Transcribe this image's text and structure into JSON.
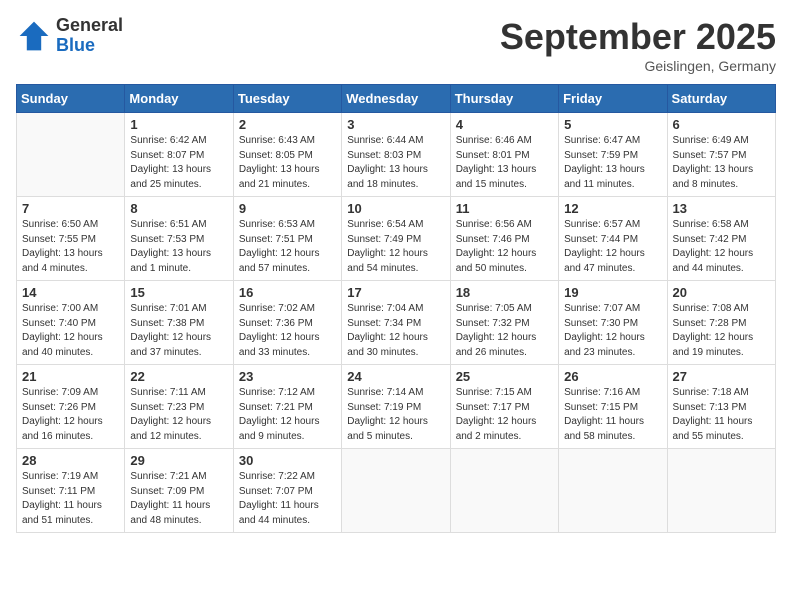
{
  "header": {
    "logo_general": "General",
    "logo_blue": "Blue",
    "month_title": "September 2025",
    "location": "Geislingen, Germany"
  },
  "days_of_week": [
    "Sunday",
    "Monday",
    "Tuesday",
    "Wednesday",
    "Thursday",
    "Friday",
    "Saturday"
  ],
  "weeks": [
    [
      {
        "day": "",
        "sunrise": "",
        "sunset": "",
        "daylight": ""
      },
      {
        "day": "1",
        "sunrise": "Sunrise: 6:42 AM",
        "sunset": "Sunset: 8:07 PM",
        "daylight": "Daylight: 13 hours and 25 minutes."
      },
      {
        "day": "2",
        "sunrise": "Sunrise: 6:43 AM",
        "sunset": "Sunset: 8:05 PM",
        "daylight": "Daylight: 13 hours and 21 minutes."
      },
      {
        "day": "3",
        "sunrise": "Sunrise: 6:44 AM",
        "sunset": "Sunset: 8:03 PM",
        "daylight": "Daylight: 13 hours and 18 minutes."
      },
      {
        "day": "4",
        "sunrise": "Sunrise: 6:46 AM",
        "sunset": "Sunset: 8:01 PM",
        "daylight": "Daylight: 13 hours and 15 minutes."
      },
      {
        "day": "5",
        "sunrise": "Sunrise: 6:47 AM",
        "sunset": "Sunset: 7:59 PM",
        "daylight": "Daylight: 13 hours and 11 minutes."
      },
      {
        "day": "6",
        "sunrise": "Sunrise: 6:49 AM",
        "sunset": "Sunset: 7:57 PM",
        "daylight": "Daylight: 13 hours and 8 minutes."
      }
    ],
    [
      {
        "day": "7",
        "sunrise": "Sunrise: 6:50 AM",
        "sunset": "Sunset: 7:55 PM",
        "daylight": "Daylight: 13 hours and 4 minutes."
      },
      {
        "day": "8",
        "sunrise": "Sunrise: 6:51 AM",
        "sunset": "Sunset: 7:53 PM",
        "daylight": "Daylight: 13 hours and 1 minute."
      },
      {
        "day": "9",
        "sunrise": "Sunrise: 6:53 AM",
        "sunset": "Sunset: 7:51 PM",
        "daylight": "Daylight: 12 hours and 57 minutes."
      },
      {
        "day": "10",
        "sunrise": "Sunrise: 6:54 AM",
        "sunset": "Sunset: 7:49 PM",
        "daylight": "Daylight: 12 hours and 54 minutes."
      },
      {
        "day": "11",
        "sunrise": "Sunrise: 6:56 AM",
        "sunset": "Sunset: 7:46 PM",
        "daylight": "Daylight: 12 hours and 50 minutes."
      },
      {
        "day": "12",
        "sunrise": "Sunrise: 6:57 AM",
        "sunset": "Sunset: 7:44 PM",
        "daylight": "Daylight: 12 hours and 47 minutes."
      },
      {
        "day": "13",
        "sunrise": "Sunrise: 6:58 AM",
        "sunset": "Sunset: 7:42 PM",
        "daylight": "Daylight: 12 hours and 44 minutes."
      }
    ],
    [
      {
        "day": "14",
        "sunrise": "Sunrise: 7:00 AM",
        "sunset": "Sunset: 7:40 PM",
        "daylight": "Daylight: 12 hours and 40 minutes."
      },
      {
        "day": "15",
        "sunrise": "Sunrise: 7:01 AM",
        "sunset": "Sunset: 7:38 PM",
        "daylight": "Daylight: 12 hours and 37 minutes."
      },
      {
        "day": "16",
        "sunrise": "Sunrise: 7:02 AM",
        "sunset": "Sunset: 7:36 PM",
        "daylight": "Daylight: 12 hours and 33 minutes."
      },
      {
        "day": "17",
        "sunrise": "Sunrise: 7:04 AM",
        "sunset": "Sunset: 7:34 PM",
        "daylight": "Daylight: 12 hours and 30 minutes."
      },
      {
        "day": "18",
        "sunrise": "Sunrise: 7:05 AM",
        "sunset": "Sunset: 7:32 PM",
        "daylight": "Daylight: 12 hours and 26 minutes."
      },
      {
        "day": "19",
        "sunrise": "Sunrise: 7:07 AM",
        "sunset": "Sunset: 7:30 PM",
        "daylight": "Daylight: 12 hours and 23 minutes."
      },
      {
        "day": "20",
        "sunrise": "Sunrise: 7:08 AM",
        "sunset": "Sunset: 7:28 PM",
        "daylight": "Daylight: 12 hours and 19 minutes."
      }
    ],
    [
      {
        "day": "21",
        "sunrise": "Sunrise: 7:09 AM",
        "sunset": "Sunset: 7:26 PM",
        "daylight": "Daylight: 12 hours and 16 minutes."
      },
      {
        "day": "22",
        "sunrise": "Sunrise: 7:11 AM",
        "sunset": "Sunset: 7:23 PM",
        "daylight": "Daylight: 12 hours and 12 minutes."
      },
      {
        "day": "23",
        "sunrise": "Sunrise: 7:12 AM",
        "sunset": "Sunset: 7:21 PM",
        "daylight": "Daylight: 12 hours and 9 minutes."
      },
      {
        "day": "24",
        "sunrise": "Sunrise: 7:14 AM",
        "sunset": "Sunset: 7:19 PM",
        "daylight": "Daylight: 12 hours and 5 minutes."
      },
      {
        "day": "25",
        "sunrise": "Sunrise: 7:15 AM",
        "sunset": "Sunset: 7:17 PM",
        "daylight": "Daylight: 12 hours and 2 minutes."
      },
      {
        "day": "26",
        "sunrise": "Sunrise: 7:16 AM",
        "sunset": "Sunset: 7:15 PM",
        "daylight": "Daylight: 11 hours and 58 minutes."
      },
      {
        "day": "27",
        "sunrise": "Sunrise: 7:18 AM",
        "sunset": "Sunset: 7:13 PM",
        "daylight": "Daylight: 11 hours and 55 minutes."
      }
    ],
    [
      {
        "day": "28",
        "sunrise": "Sunrise: 7:19 AM",
        "sunset": "Sunset: 7:11 PM",
        "daylight": "Daylight: 11 hours and 51 minutes."
      },
      {
        "day": "29",
        "sunrise": "Sunrise: 7:21 AM",
        "sunset": "Sunset: 7:09 PM",
        "daylight": "Daylight: 11 hours and 48 minutes."
      },
      {
        "day": "30",
        "sunrise": "Sunrise: 7:22 AM",
        "sunset": "Sunset: 7:07 PM",
        "daylight": "Daylight: 11 hours and 44 minutes."
      },
      {
        "day": "",
        "sunrise": "",
        "sunset": "",
        "daylight": ""
      },
      {
        "day": "",
        "sunrise": "",
        "sunset": "",
        "daylight": ""
      },
      {
        "day": "",
        "sunrise": "",
        "sunset": "",
        "daylight": ""
      },
      {
        "day": "",
        "sunrise": "",
        "sunset": "",
        "daylight": ""
      }
    ]
  ]
}
